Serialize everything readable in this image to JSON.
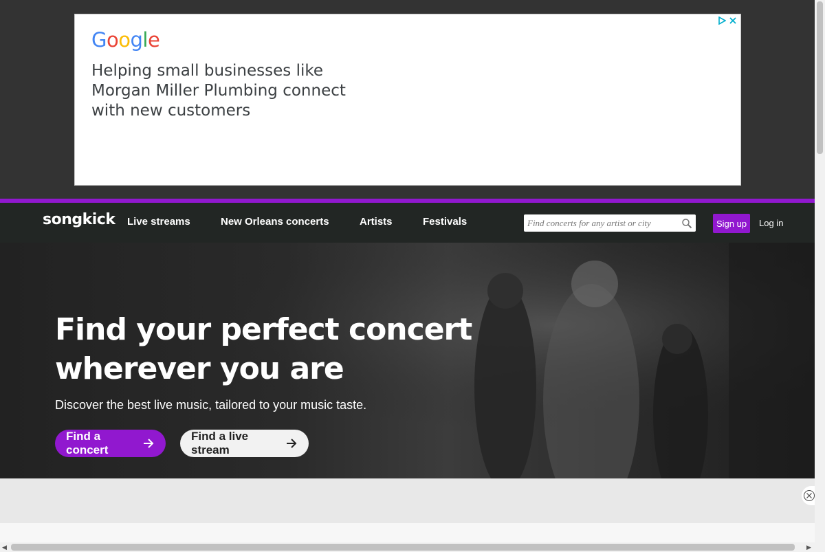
{
  "ad": {
    "logo": "Google",
    "text": "Helping small businesses like Morgan Miller Plumbing connect with new customers",
    "icons": [
      "adchoices-icon",
      "close-icon"
    ]
  },
  "nav": {
    "logo": "songkick",
    "links": [
      "Live streams",
      "New Orleans concerts",
      "Artists",
      "Festivals"
    ],
    "search_placeholder": "Find concerts for any artist or city",
    "signup": "Sign up",
    "login": "Log in"
  },
  "hero": {
    "title": "Find your perfect concert wherever you are",
    "subtitle": "Discover the best live music, tailored to your music taste.",
    "primary_button": "Find a concert",
    "secondary_button": "Find a live stream"
  },
  "colors": {
    "brand_purple": "#9118cf",
    "nav_bg": "#222624",
    "page_bg": "#333333"
  }
}
